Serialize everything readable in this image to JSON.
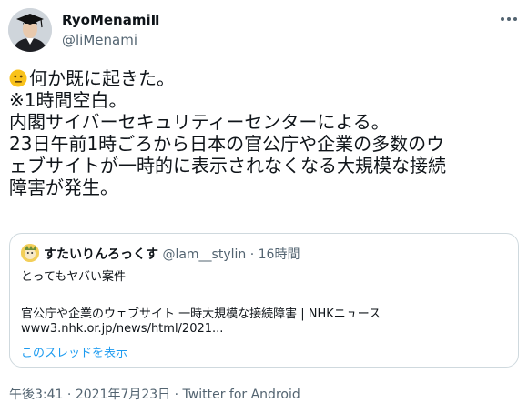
{
  "user": {
    "display_name": "RyoMenamiⅡ",
    "handle": "@liMenami",
    "avatar_icon": "graduate-avatar"
  },
  "more_icon": "more-horizontal-icon",
  "tweet": {
    "emoji": "neutral-face-emoji",
    "lines": [
      "何か既に起きた。",
      "※1時間空白。",
      "内閣サイバーセキュリティーセンターによる。",
      "23日午前1時ごろから日本の官公庁や企業の多数のウ",
      "ェブサイトが一時的に表示されなくなる大規模な接続",
      "障害が発生。"
    ]
  },
  "quote": {
    "avatar_icon": "cartoon-avatar",
    "name": "すたいりんろっくす",
    "handle": "@lam__stylin",
    "separator": "·",
    "time": "16時間",
    "body": "とってもヤバい案件",
    "link_title": "官公庁や企業のウェブサイト 一時大規模な接続障害 | NHKニュース",
    "link_url": "www3.nhk.or.jp/news/html/2021...",
    "show_thread": "このスレッドを表示"
  },
  "footer": {
    "time": "午後3:41",
    "date": "2021年7月23日",
    "separator": "·",
    "source": "Twitter for Android"
  },
  "colors": {
    "text": "#0f1419",
    "secondary": "#536471",
    "link": "#1d9bf0",
    "border": "#cfd9de"
  }
}
